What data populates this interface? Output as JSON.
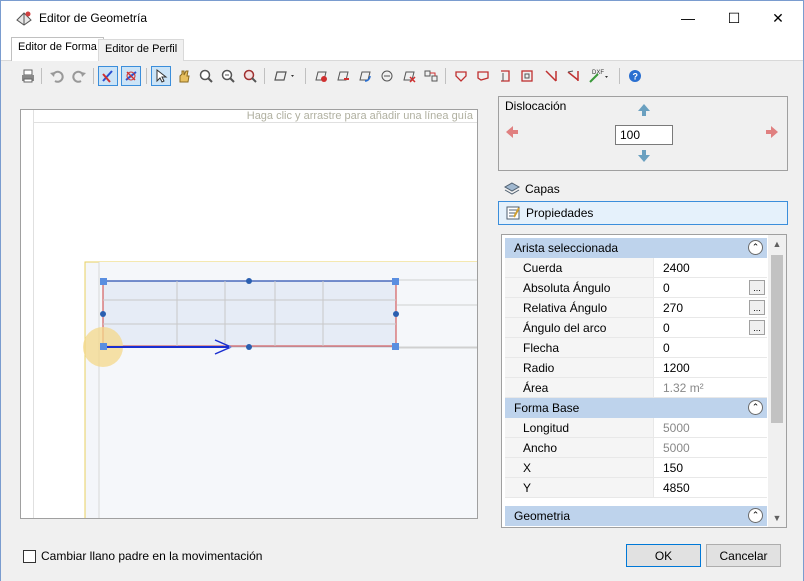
{
  "window": {
    "title": "Editor de Geometría",
    "minimize": "—",
    "maximize": "☐",
    "close": "✕"
  },
  "tabs": [
    {
      "label": "Editor de Forma",
      "active": true
    },
    {
      "label": "Editor de Perfil",
      "active": false
    }
  ],
  "toolbar": {
    "icons": [
      "print-icon",
      "undo-icon",
      "redo-icon",
      "edit-vertices-icon",
      "edit-edges-icon",
      "select-icon",
      "pan-icon",
      "zoom-in-icon",
      "zoom-out-icon",
      "zoom-fit-icon",
      "shape-dropdown-icon",
      "add-vertex-icon",
      "delete-vertex-icon",
      "rotate-icon",
      "mirror-icon",
      "delete-shape-icon",
      "align-icon",
      "shape-a-icon",
      "shape-b-icon",
      "shape-c-icon",
      "shape-d-icon",
      "cut-a-icon",
      "cut-b-icon",
      "dxf-icon",
      "help-icon"
    ]
  },
  "canvas": {
    "hint": "Haga clic y arrastre para añadir una línea guía"
  },
  "dislocacion": {
    "label": "Dislocación",
    "value": "100"
  },
  "panels": {
    "capas": "Capas",
    "propiedades": "Propiedades"
  },
  "properties": {
    "sections": [
      {
        "title": "Arista seleccionada",
        "rows": [
          {
            "name": "Cuerda",
            "value": "2400",
            "readonly": false,
            "ellipsis": false
          },
          {
            "name": "Absoluta Ángulo",
            "value": "0",
            "readonly": false,
            "ellipsis": true
          },
          {
            "name": "Relativa Ángulo",
            "value": "270",
            "readonly": false,
            "ellipsis": true
          },
          {
            "name": "Ángulo del arco",
            "value": "0",
            "readonly": false,
            "ellipsis": true
          },
          {
            "name": "Flecha",
            "value": "0",
            "readonly": false,
            "ellipsis": false
          },
          {
            "name": "Radio",
            "value": "1200",
            "readonly": false,
            "ellipsis": false
          },
          {
            "name": "Área",
            "value": "1.32 m²",
            "readonly": true,
            "ellipsis": false
          }
        ]
      },
      {
        "title": "Forma Base",
        "rows": [
          {
            "name": "Longitud",
            "value": "5000",
            "readonly": true,
            "ellipsis": false
          },
          {
            "name": "Ancho",
            "value": "5000",
            "readonly": true,
            "ellipsis": false
          },
          {
            "name": "X",
            "value": "150",
            "readonly": false,
            "ellipsis": false
          },
          {
            "name": "Y",
            "value": "4850",
            "readonly": false,
            "ellipsis": false
          }
        ]
      },
      {
        "title": "Geometria",
        "rows": []
      }
    ],
    "ellipsis_label": "..."
  },
  "footer": {
    "checkbox_label": "Cambiar llano padre en la movimentación",
    "ok": "OK",
    "cancel": "Cancelar"
  }
}
